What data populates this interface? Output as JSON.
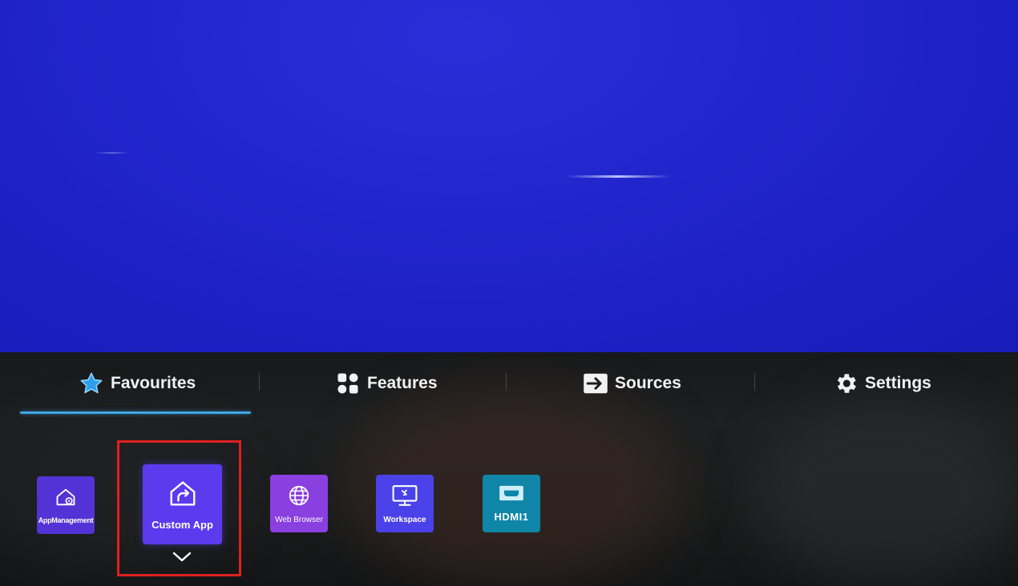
{
  "tabs": [
    {
      "label": "Favourites",
      "icon": "star-icon",
      "active": true
    },
    {
      "label": "Features",
      "icon": "features-grid-icon",
      "active": false
    },
    {
      "label": "Sources",
      "icon": "source-input-icon",
      "active": false
    },
    {
      "label": "Settings",
      "icon": "gear-icon",
      "active": false
    }
  ],
  "apps": [
    {
      "label": "AppManagement",
      "icon": "home-gear-icon",
      "color": "#5333d6"
    },
    {
      "label": "Custom App",
      "icon": "home-share-icon",
      "color": "#5a3bee",
      "focused": true
    },
    {
      "label": "Web Browser",
      "icon": "globe-icon",
      "color": "#8a3fe0"
    },
    {
      "label": "Workspace",
      "icon": "monitor-icon",
      "color": "#4a42e8"
    },
    {
      "label": "HDMI1",
      "icon": "hdmi-port-icon",
      "color": "#0f86a8"
    }
  ],
  "colors": {
    "active_tab_underline": "#3fa7e6",
    "highlight_border": "#e0201f",
    "screen_blue": "#2126cc"
  }
}
